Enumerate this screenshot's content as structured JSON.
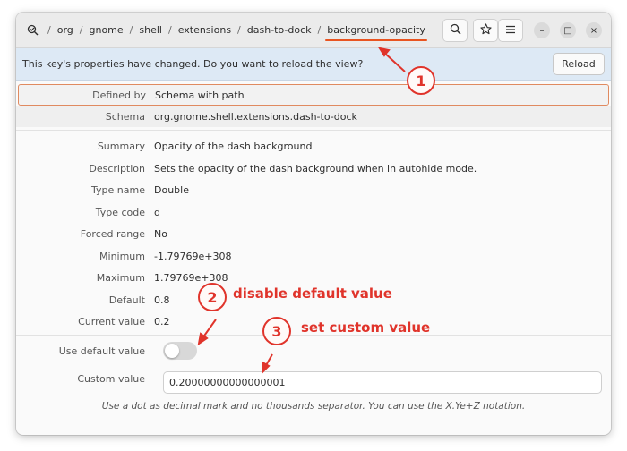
{
  "breadcrumb": {
    "items": [
      "org",
      "gnome",
      "shell",
      "extensions",
      "dash-to-dock",
      "background-opacity"
    ],
    "separator": "/"
  },
  "header_buttons": {
    "search_icon": "search-icon",
    "bookmark_icon": "star-icon",
    "menu_icon": "hamburger-menu-icon"
  },
  "window_controls": {
    "minimize": "–",
    "maximize": "□",
    "close": "×"
  },
  "infobar": {
    "message": "This key's properties have changed. Do you want to reload the view?",
    "reload_label": "Reload"
  },
  "properties": [
    {
      "label": "Defined by",
      "value": "Schema with path"
    },
    {
      "label": "Schema",
      "value": "org.gnome.shell.extensions.dash-to-dock"
    },
    {
      "label": "Summary",
      "value": "Opacity of the dash background"
    },
    {
      "label": "Description",
      "value": "Sets the opacity of the dash background when in autohide mode."
    },
    {
      "label": "Type name",
      "value": "Double"
    },
    {
      "label": "Type code",
      "value": "d"
    },
    {
      "label": "Forced range",
      "value": "No"
    },
    {
      "label": "Minimum",
      "value": "-1.79769e+308"
    },
    {
      "label": "Maximum",
      "value": "1.79769e+308"
    },
    {
      "label": "Default",
      "value": "0.8"
    },
    {
      "label": "Current value",
      "value": "0.2"
    }
  ],
  "use_default": {
    "label": "Use default value",
    "enabled": false
  },
  "custom_value": {
    "label": "Custom value",
    "value": "0.20000000000000001",
    "hint": "Use a dot as decimal mark and no thousands separator. You can use the X.Ye+Z notation."
  },
  "annotations": [
    {
      "number": "1",
      "text": ""
    },
    {
      "number": "2",
      "text": "disable default value"
    },
    {
      "number": "3",
      "text": "set custom value"
    }
  ],
  "colors": {
    "accent": "#e95420",
    "annotation": "#e0342b",
    "infobar_bg": "#dde9f5"
  }
}
